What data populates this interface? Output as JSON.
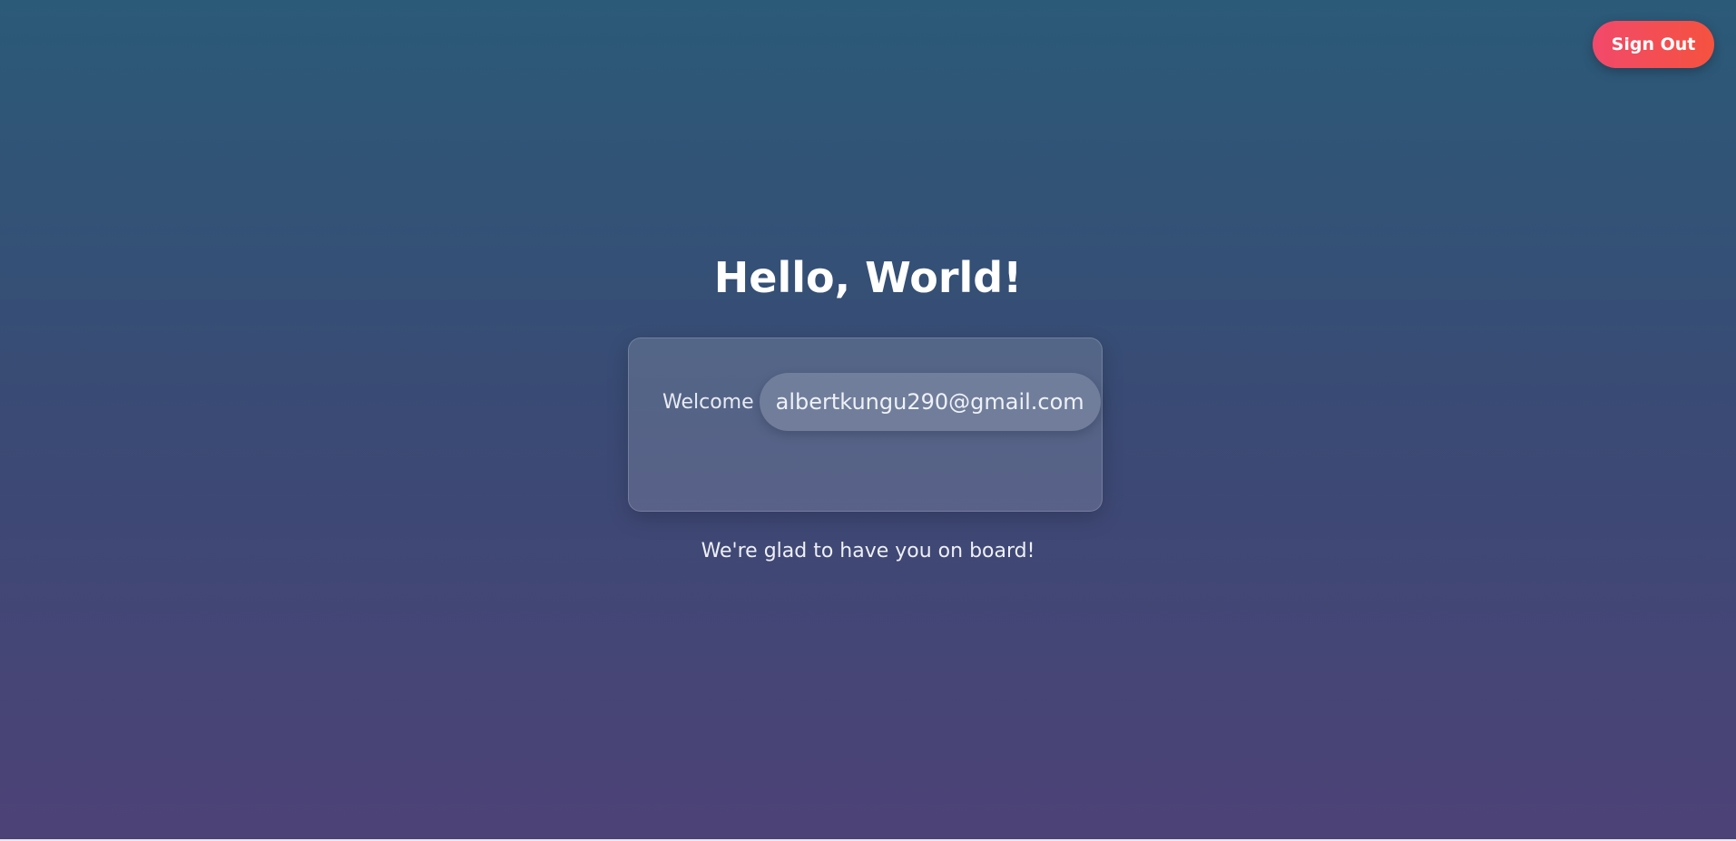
{
  "header": {
    "sign_out_label": "Sign Out"
  },
  "main": {
    "title": "Hello, World!",
    "card": {
      "welcome_label": "Welcome",
      "email": "albertkungu290@gmail.com"
    },
    "subtitle": "We're glad to have you on board!"
  },
  "colors": {
    "background_top": "#2b5a78",
    "background_bottom": "#4d4277",
    "sign_out_start": "#f2496b",
    "sign_out_end": "#f5523f"
  }
}
